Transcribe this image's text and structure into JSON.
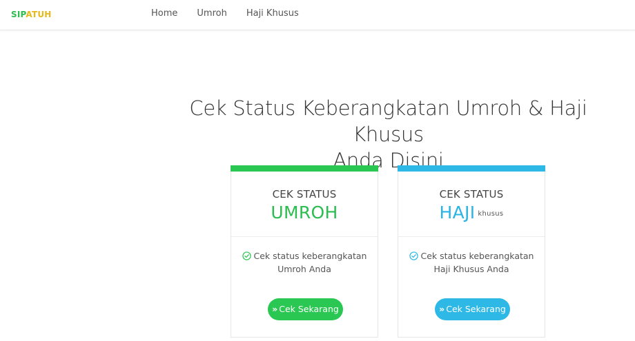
{
  "brand": {
    "part_a": "SIP",
    "part_b": "ATUH"
  },
  "nav": {
    "items": [
      "Home",
      "Umroh",
      "Haji Khusus"
    ]
  },
  "hero": {
    "line1": "Cek Status Keberangkatan Umroh & Haji Khusus",
    "line2": "Anda Disini"
  },
  "cards": [
    {
      "kicker": "CEK STATUS",
      "title": "UMROH",
      "subtitle": "",
      "feature_line1": "Cek status keberangkatan",
      "feature_line2": "Umroh Anda",
      "button": "Cek Sekarang",
      "accent": "#2bc753",
      "icon": "check-circle-icon"
    },
    {
      "kicker": "CEK STATUS",
      "title": "HAJI",
      "subtitle": "khusus",
      "feature_line1": "Cek status keberangkatan",
      "feature_line2": "Haji Khusus Anda",
      "button": "Cek Sekarang",
      "accent": "#2db8e6",
      "icon": "check-circle-icon"
    }
  ],
  "colors": {
    "green": "#2bc753",
    "blue": "#2db8e6",
    "brand_gold": "#e7b81a"
  }
}
